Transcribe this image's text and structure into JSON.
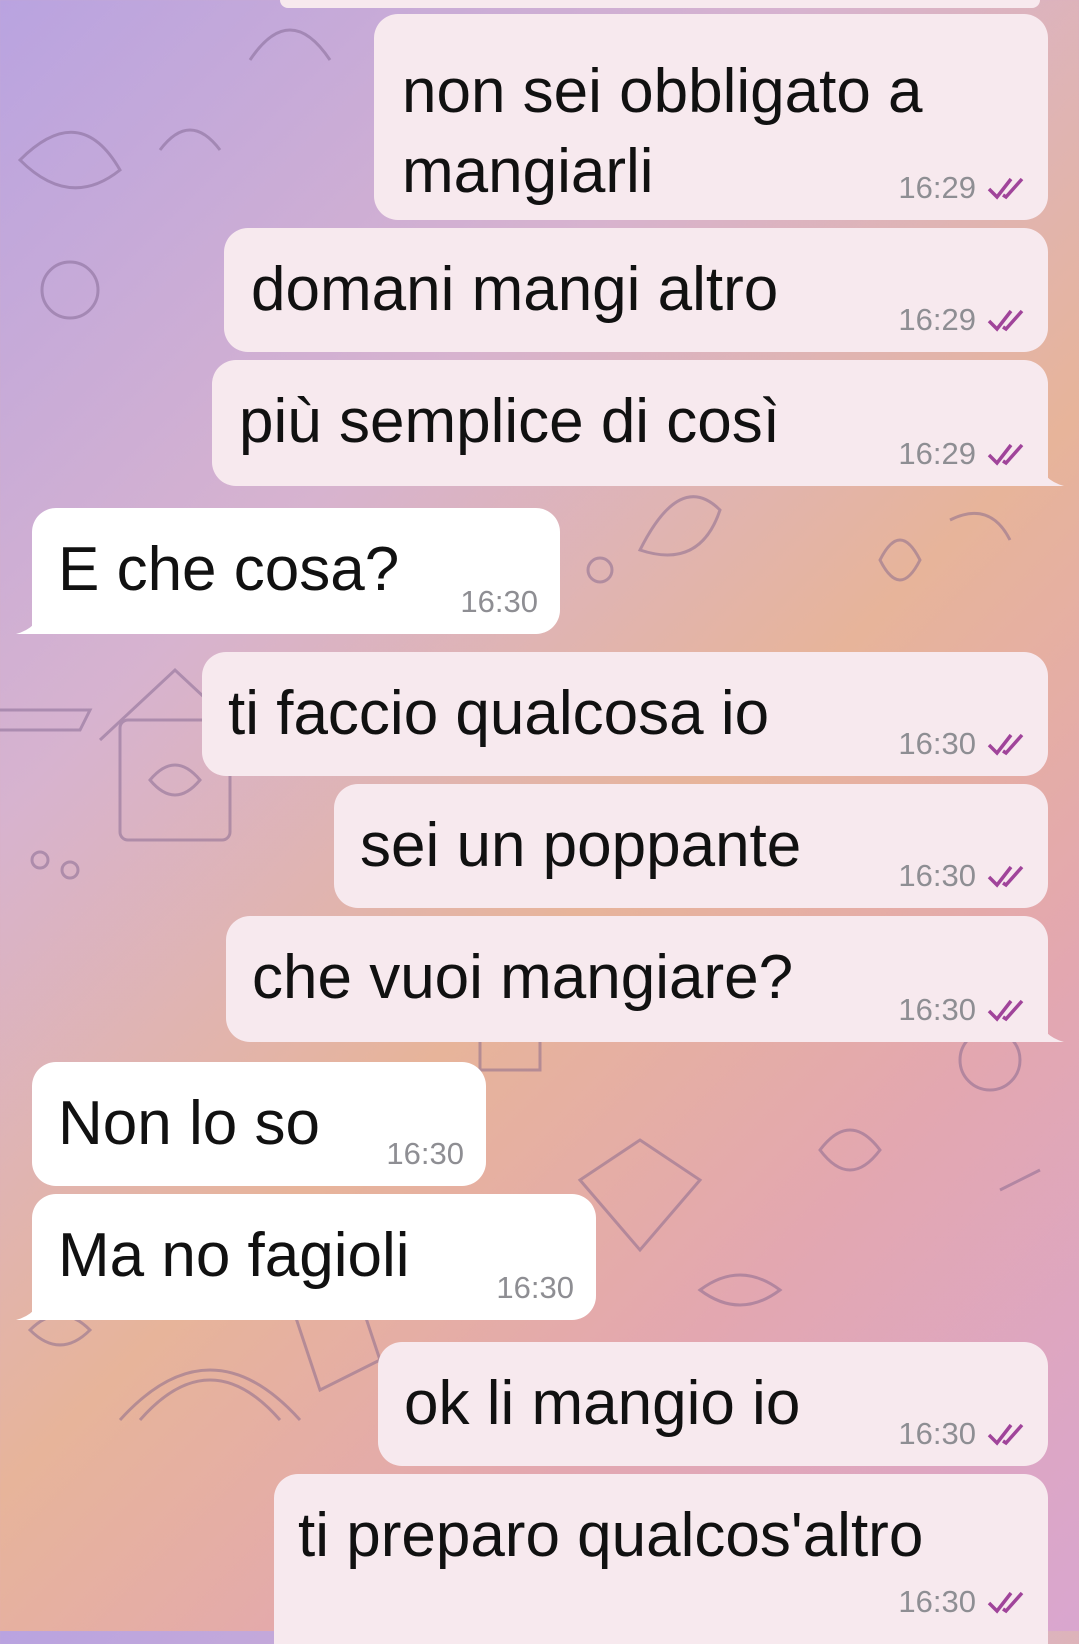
{
  "messages": [
    {
      "dir": "out",
      "text": "non sei obbligato a\nmangiarli",
      "time": "16:29",
      "status": "read"
    },
    {
      "dir": "out",
      "text": "domani mangi altro",
      "time": "16:29",
      "status": "read"
    },
    {
      "dir": "out",
      "text": "più semplice di così",
      "time": "16:29",
      "status": "read"
    },
    {
      "dir": "in",
      "text": "E che cosa?",
      "time": "16:30"
    },
    {
      "dir": "out",
      "text": "ti faccio qualcosa io",
      "time": "16:30",
      "status": "read"
    },
    {
      "dir": "out",
      "text": "sei un poppante",
      "time": "16:30",
      "status": "read"
    },
    {
      "dir": "out",
      "text": "che vuoi mangiare?",
      "time": "16:30",
      "status": "read"
    },
    {
      "dir": "in",
      "text": "Non lo so",
      "time": "16:30"
    },
    {
      "dir": "in",
      "text": "Ma no fagioli",
      "time": "16:30"
    },
    {
      "dir": "out",
      "text": "ok li mangio io",
      "time": "16:30",
      "status": "read"
    },
    {
      "dir": "out",
      "text": "ti preparo qualcos'altro",
      "time": "16:30",
      "status": "read"
    }
  ],
  "colors": {
    "outgoing_bubble": "#f7e9ee",
    "incoming_bubble": "#ffffff",
    "read_ticks": "#a0449a",
    "time_text": "#8e8e93"
  },
  "icons": {
    "read_status": "double-check-icon"
  }
}
